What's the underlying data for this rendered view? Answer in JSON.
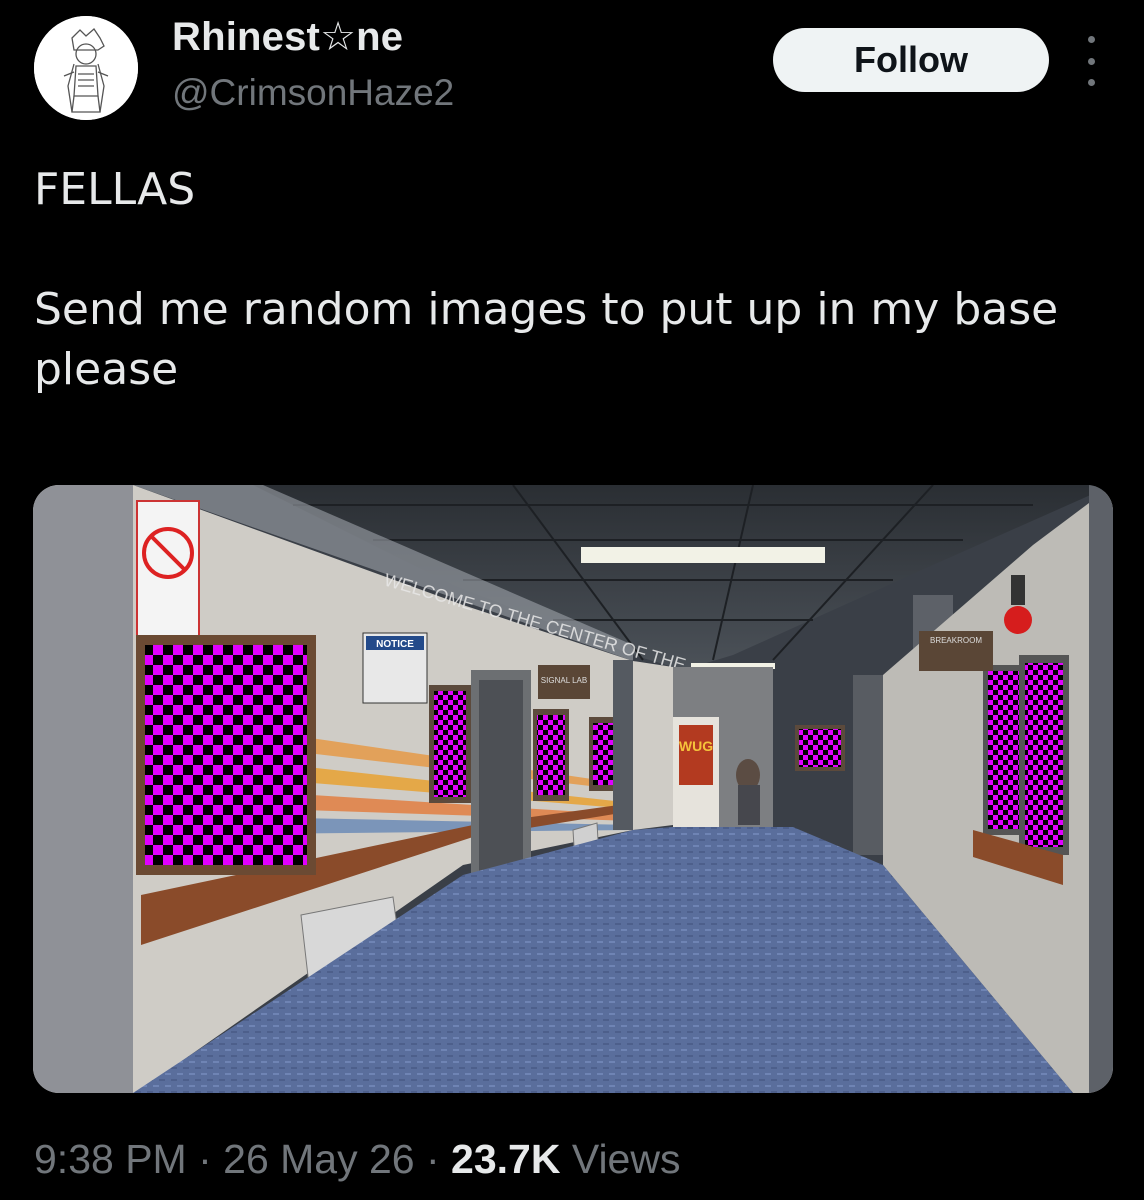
{
  "author": {
    "display_name": "Rhinest☆ne",
    "handle": "@CrimsonHaze2"
  },
  "follow_label": "Follow",
  "tweet": {
    "line1": "FELLAS",
    "line2": "Send me random images to put up in my base please"
  },
  "media_signs": {
    "welcome": "WELCOME TO THE CENTER OF THE ...",
    "notice": "NOTICE",
    "signal_lab": "SIGNAL LAB",
    "vending": "WUG",
    "breakroom": "BREAKROOM"
  },
  "meta": {
    "time": "9:38 PM",
    "sep1": " · ",
    "date": "26 May 26",
    "sep2": " · ",
    "views_count": "23.7K",
    "views_label": " Views"
  },
  "colors": {
    "background": "#000000",
    "text": "#e7e9ea",
    "secondary": "#71767b",
    "follow_bg": "#eff3f4",
    "checker_magenta": "#e000ff"
  },
  "icons": [
    "avatar-sketch",
    "more-dots-icon"
  ]
}
